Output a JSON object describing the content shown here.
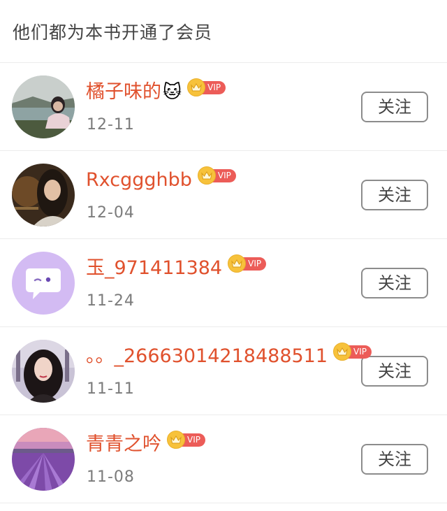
{
  "header": {
    "title": "他们都为本书开通了会员"
  },
  "vip_badge": {
    "label": "VIP",
    "crown_icon": "crown-icon"
  },
  "colors": {
    "name": "#e0512d",
    "vip_tag": "#ec5c58",
    "crown": "#f7c23b"
  },
  "members": [
    {
      "name": "橘子味的",
      "emoji": "🐱",
      "date": "12-11",
      "follow_label": "关注",
      "avatar": "lake-landscape-avatar"
    },
    {
      "name": "Rxcggghbb",
      "emoji": "",
      "date": "12-04",
      "follow_label": "关注",
      "avatar": "portrait-avatar"
    },
    {
      "name": "玉_971411384",
      "emoji": "",
      "date": "11-24",
      "follow_label": "关注",
      "avatar": "chat-bubble-avatar"
    },
    {
      "name": "。。_26663014218488511",
      "emoji": "",
      "date": "11-11",
      "follow_label": "关注",
      "avatar": "selfie-avatar"
    },
    {
      "name": "青青之吟",
      "emoji": "",
      "date": "11-08",
      "follow_label": "关注",
      "avatar": "lavender-field-avatar"
    }
  ]
}
